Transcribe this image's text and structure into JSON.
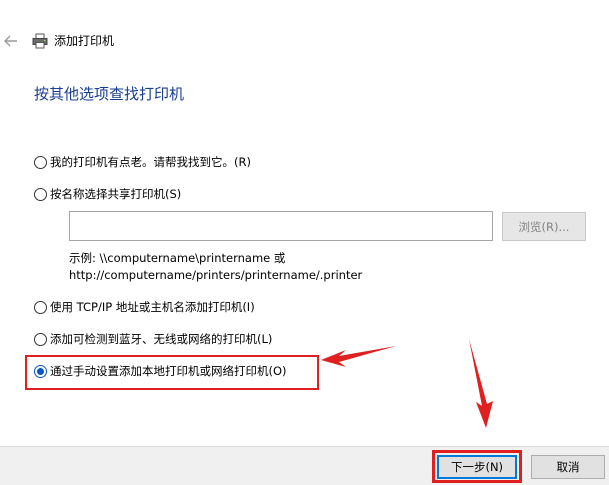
{
  "window": {
    "title": "添加打印机"
  },
  "heading": "按其他选项查找打印机",
  "options": [
    {
      "label": "我的打印机有点老。请帮我找到它。(R)",
      "checked": false
    },
    {
      "label": "按名称选择共享打印机(S)",
      "checked": false
    },
    {
      "label": "使用 TCP/IP 地址或主机名添加打印机(I)",
      "checked": false
    },
    {
      "label": "添加可检测到蓝牙、无线或网络的打印机(L)",
      "checked": false
    },
    {
      "label": "通过手动设置添加本地打印机或网络打印机(O)",
      "checked": true
    }
  ],
  "shared": {
    "input_value": "",
    "browse_label": "浏览(R)...",
    "example_line1": "示例: \\\\computername\\printername 或",
    "example_line2": "http://computername/printers/printername/.printer"
  },
  "footer": {
    "next_label": "下一步(N)",
    "cancel_label": "取消"
  },
  "annotation": {
    "color": "#e02020"
  },
  "icons": [
    "back-arrow-icon",
    "printer-icon",
    "close-icon",
    "annotation-arrow-icon"
  ]
}
